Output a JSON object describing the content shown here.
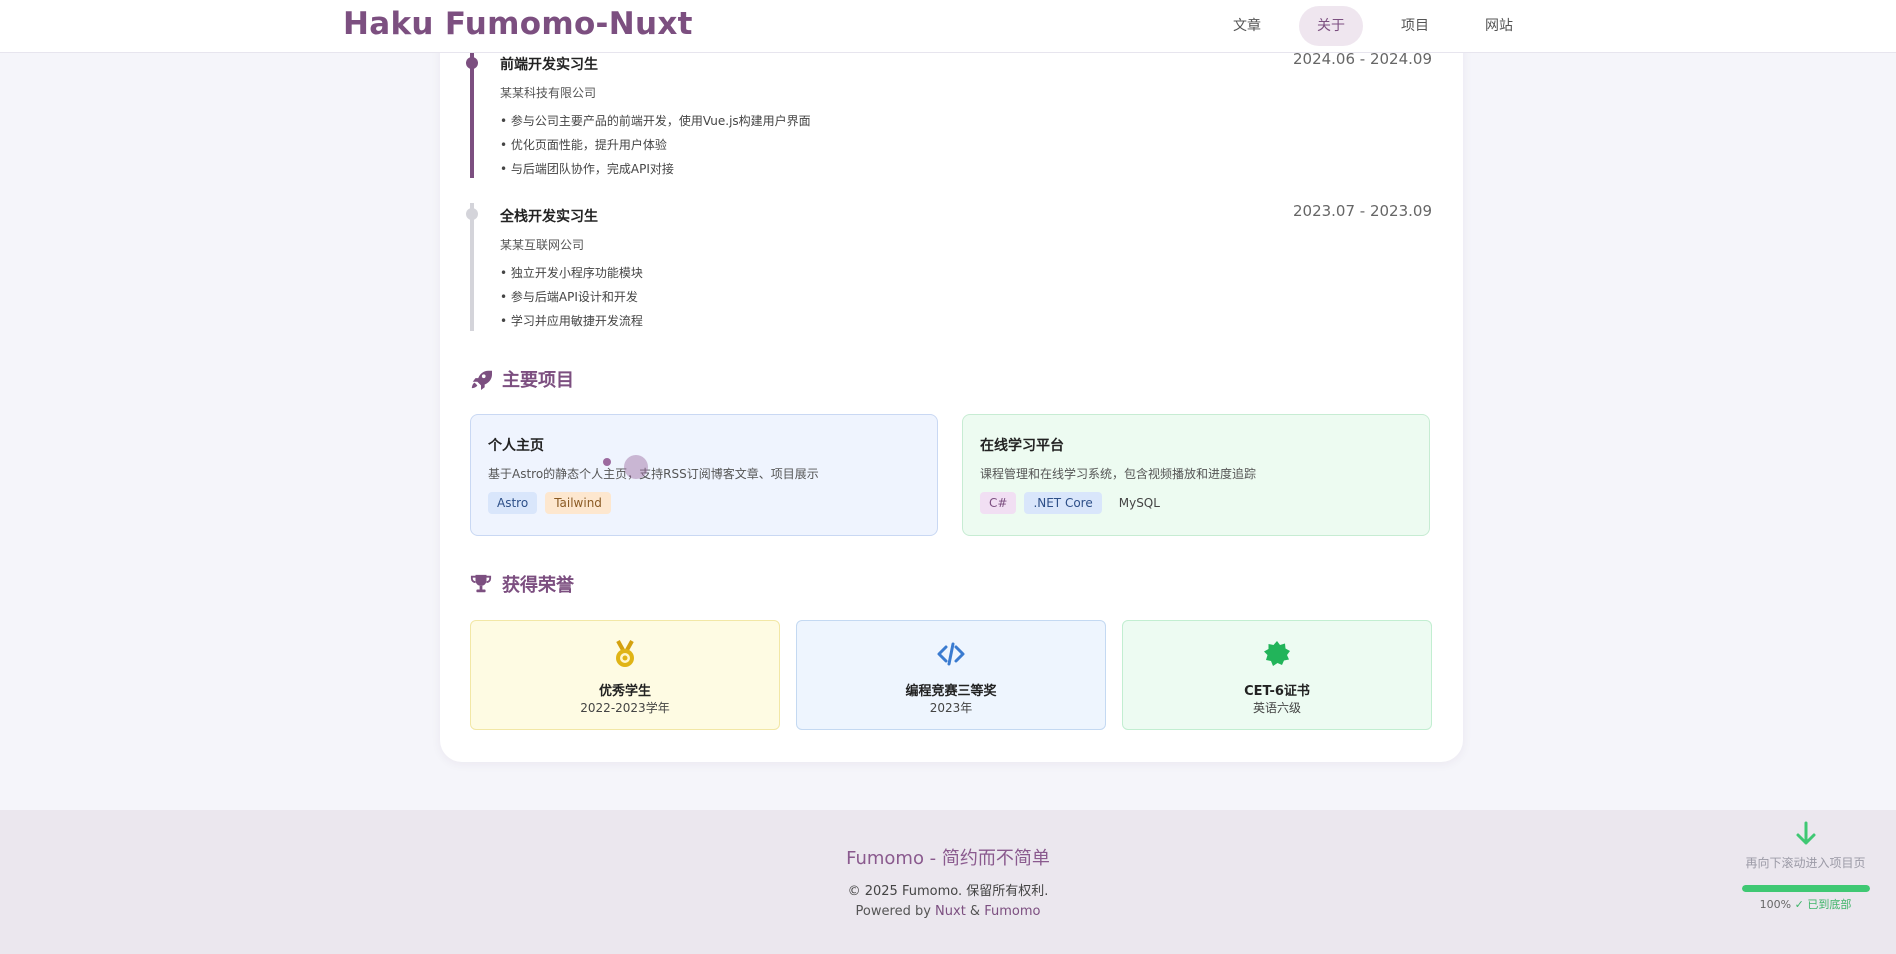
{
  "header": {
    "brand": "Haku Fumomo-Nuxt",
    "nav": [
      {
        "label": "文章",
        "active": false
      },
      {
        "label": "关于",
        "active": true
      },
      {
        "label": "项目",
        "active": false
      },
      {
        "label": "网站",
        "active": false
      }
    ]
  },
  "experience": [
    {
      "title": "前端开发实习生",
      "date": "2024.06 - 2024.09",
      "company": "某某科技有限公司",
      "bullets": [
        "• 参与公司主要产品的前端开发，使用Vue.js构建用户界面",
        "• 优化页面性能，提升用户体验",
        "• 与后端团队协作，完成API对接"
      ]
    },
    {
      "title": "全栈开发实习生",
      "date": "2023.07 - 2023.09",
      "company": "某某互联网公司",
      "bullets": [
        "• 独立开发小程序功能模块",
        "• 参与后端API设计和开发",
        "• 学习并应用敏捷开发流程"
      ]
    }
  ],
  "projects_section": {
    "title": "主要项目",
    "icon": "rocket-icon"
  },
  "projects": [
    {
      "title": "个人主页",
      "desc": "基于Astro的静态个人主页，支持RSS订阅博客文章、项目展示",
      "tags": [
        "Astro",
        "Tailwind"
      ]
    },
    {
      "title": "在线学习平台",
      "desc": "课程管理和在线学习系统，包含视频播放和进度追踪",
      "tags": [
        "C#",
        ".NET Core",
        "MySQL"
      ]
    }
  ],
  "honors_section": {
    "title": "获得荣誉",
    "icon": "trophy-icon"
  },
  "honors": [
    {
      "title": "优秀学生",
      "sub": "2022-2023学年",
      "icon": "medal-icon"
    },
    {
      "title": "编程竞赛三等奖",
      "sub": "2023年",
      "icon": "code-icon"
    },
    {
      "title": "CET-6证书",
      "sub": "英语六级",
      "icon": "badge-icon"
    }
  ],
  "footer": {
    "title": "Fumomo - 简约而不简单",
    "copyright": "© 2025 Fumomo. 保留所有权利.",
    "powered_prefix": "Powered by ",
    "powered_nuxt": "Nuxt",
    "powered_amp": " & ",
    "powered_fumomo": "Fumomo"
  },
  "scroll_hint": {
    "icon": "arrow-down-icon",
    "text": "再向下滚动进入项目页",
    "progress": 100,
    "percent_text": "100%",
    "status": "✓ 已到底部"
  },
  "colors": {
    "brand": "#7c4f80",
    "accent_green": "#3fc873"
  }
}
